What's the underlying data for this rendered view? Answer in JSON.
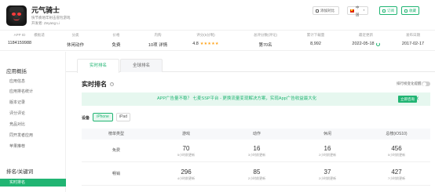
{
  "app": {
    "title": "元气骑士",
    "subtitle": "快节奏地牢射击冒险游戏",
    "developer": "开发者: Zeyang Li"
  },
  "header_buttons": {
    "compare": "添加对比",
    "country": "中国",
    "subscribe": "订阅",
    "record": "收藏"
  },
  "stats": [
    {
      "label": "APP ID",
      "value": "1184159988"
    },
    {
      "label": "模板适",
      "value": ""
    },
    {
      "label": "分类",
      "value": "休闲动作"
    },
    {
      "label": "价格",
      "value": "免费"
    },
    {
      "label": "内购",
      "value": "10项 详情"
    },
    {
      "label": "评分(5分制)",
      "value": "4.8"
    },
    {
      "label": "总评分数(评论)",
      "value": "第70名"
    },
    {
      "label": "累计下载量",
      "value": "8,992"
    },
    {
      "label": "最近更新",
      "value": "2022-05-18"
    },
    {
      "label": "发布日期",
      "value": "2017-02-17"
    }
  ],
  "stars": "★★★★★",
  "sidebar": {
    "section1": "应用概括",
    "items1": [
      "应用信息",
      "应用排名统计",
      "版本记录",
      "评分评论",
      "竞品对比",
      "同开发者应用",
      "苹果推荐"
    ],
    "section2": "排名/关键词",
    "items2": [
      "实时排名"
    ]
  },
  "tabs": {
    "realtime": "实时排名",
    "global": "全球排名"
  },
  "section_title": "实时排名",
  "help_glyph": "?",
  "notify_label": "排行榜变化提醒",
  "banner": {
    "text": "APP广告量不稳？ 七麦SSP平台 - 更换流量变现解决方案，实现App广告收益最大化",
    "button": "立即咨询",
    "close": "✕"
  },
  "device": {
    "label": "设备",
    "options": [
      "iPhone",
      "iPad"
    ],
    "selected": "iPhone"
  },
  "table": {
    "headers": [
      "榜单类型",
      "游戏",
      "动作",
      "休闲",
      "总榜(iOS10)"
    ],
    "rows": [
      {
        "type": "免费",
        "cells": [
          {
            "value": "70",
            "sub": "5小时前更新"
          },
          {
            "value": "16",
            "sub": "3小时前更新"
          },
          {
            "value": "16",
            "sub": "2小时前更新"
          },
          {
            "value": "456",
            "sub": "5小时前更新"
          }
        ]
      },
      {
        "type": "畅销",
        "cells": [
          {
            "value": "296",
            "sub": "4小时前更新"
          },
          {
            "value": "85",
            "sub": "2小时前更新"
          },
          {
            "value": "37",
            "sub": "2小时前更新"
          },
          {
            "value": "427",
            "sub": "7小时前更新"
          }
        ]
      }
    ]
  },
  "colors": {
    "accent": "#21b573",
    "banner_bg": "#e6f7ef",
    "star": "#ffa31a",
    "rank_red": "#ff5a4e"
  }
}
